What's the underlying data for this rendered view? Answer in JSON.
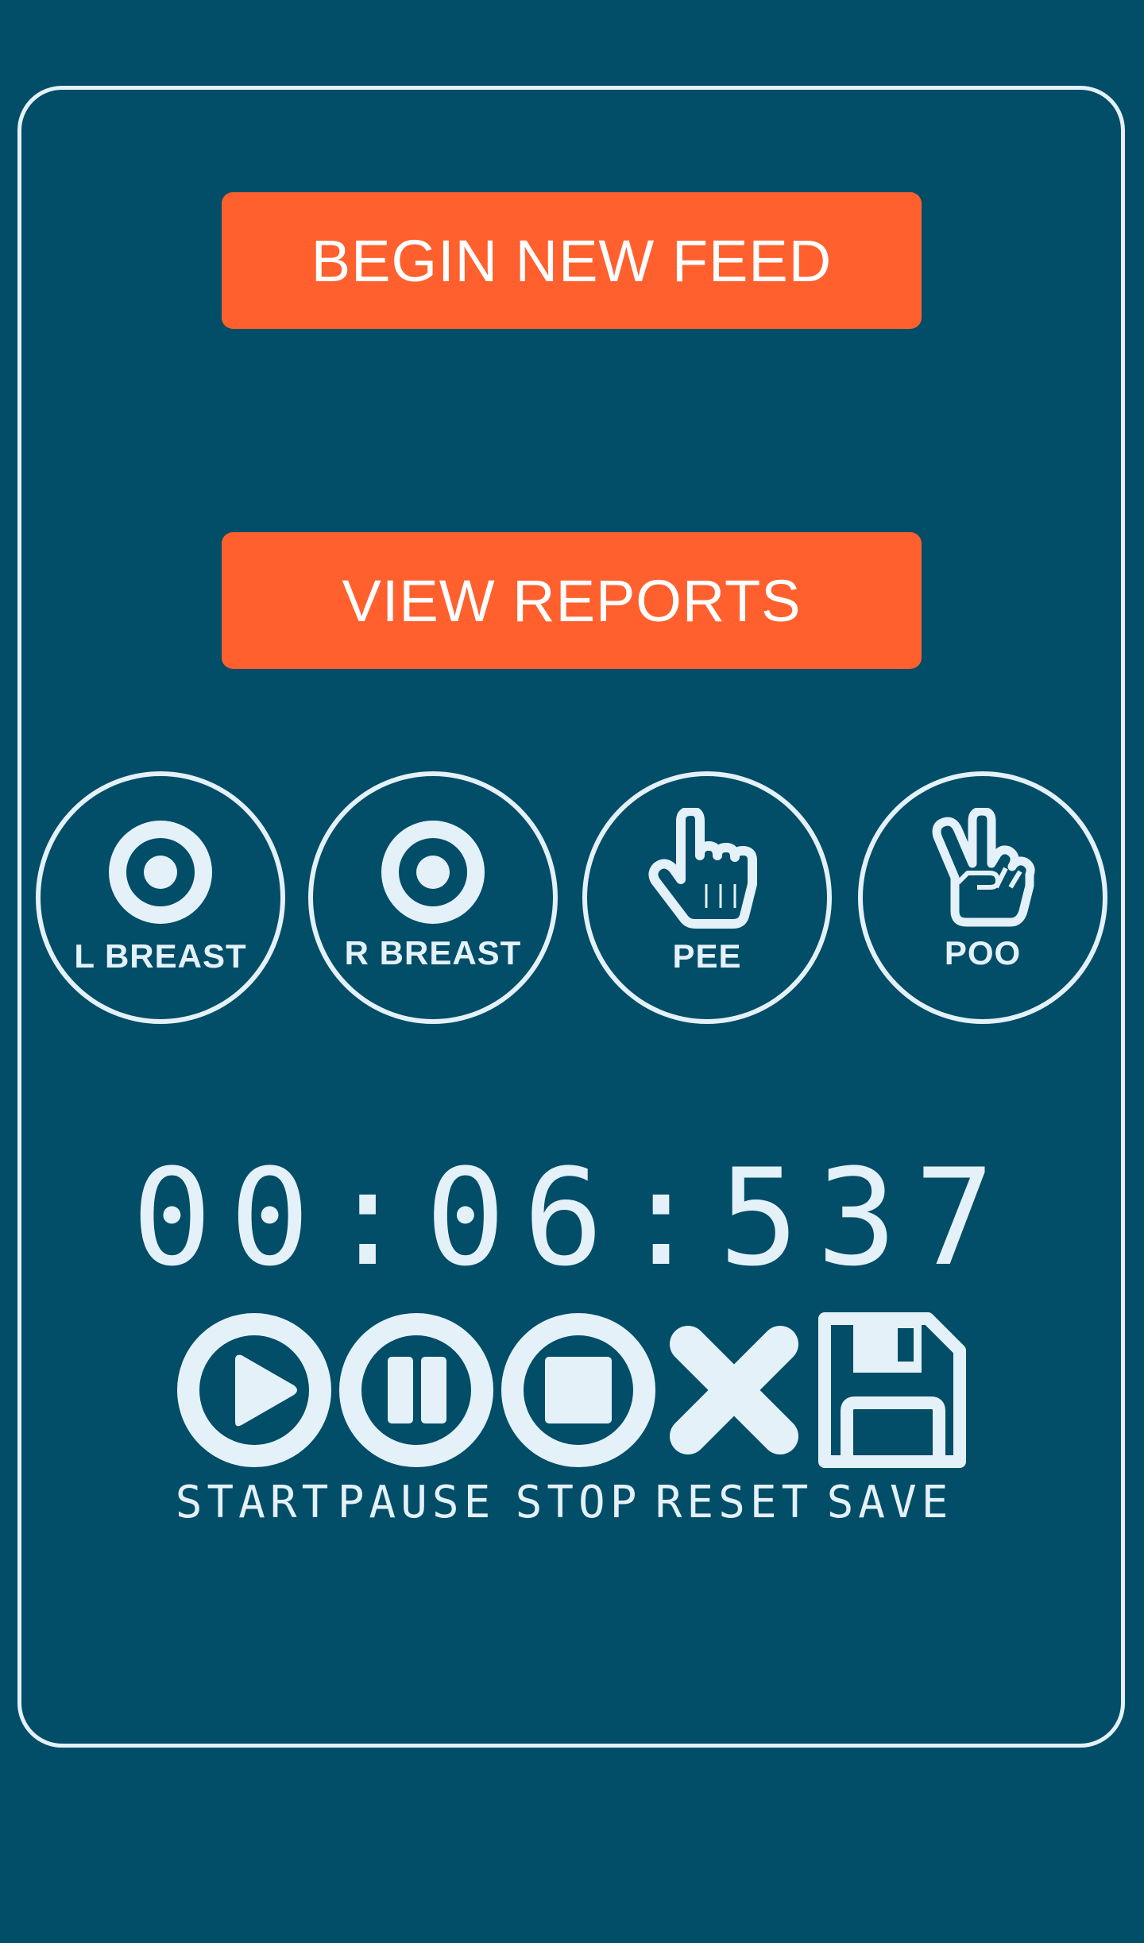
{
  "colors": {
    "background": "#024d67",
    "accent": "#ff602e",
    "foreground": "#e4f1f8"
  },
  "buttons": {
    "begin_new_feed": "BEGIN NEW FEED",
    "view_reports": "VIEW REPORTS"
  },
  "events": [
    {
      "label": "L BREAST",
      "icon": "target-icon"
    },
    {
      "label": "R BREAST",
      "icon": "target-icon"
    },
    {
      "label": "PEE",
      "icon": "pointing-finger-icon"
    },
    {
      "label": "POO",
      "icon": "two-fingers-icon"
    }
  ],
  "timer": {
    "display": "00:06:537"
  },
  "controls": [
    {
      "label": "START",
      "icon": "play-circle-icon"
    },
    {
      "label": "PAUSE",
      "icon": "pause-circle-icon"
    },
    {
      "label": "STOP",
      "icon": "stop-circle-icon"
    },
    {
      "label": "RESET",
      "icon": "x-icon"
    },
    {
      "label": "SAVE",
      "icon": "floppy-disk-icon"
    }
  ]
}
